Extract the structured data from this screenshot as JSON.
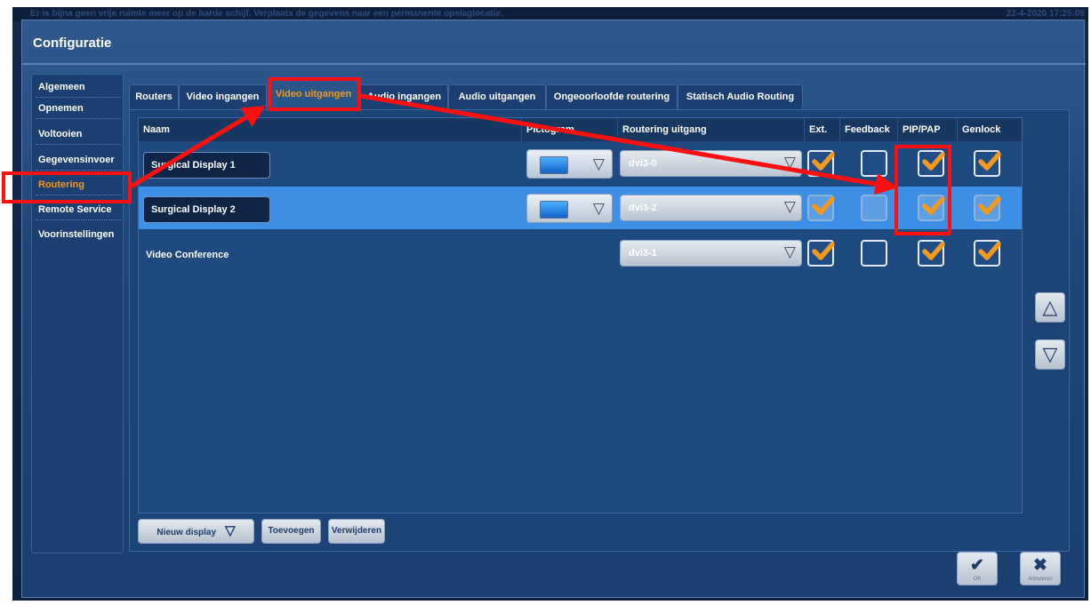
{
  "system_bar": {
    "message": "Er is bijna geen vrije ruimte meer op de harde schijf. Verplaats de gegevens naar een permanente opslaglocatie.",
    "clock": "22-4-2020  17:25:09"
  },
  "dialog": {
    "title": "Configuratie"
  },
  "sidebar": {
    "items": [
      {
        "label": "Algemeen"
      },
      {
        "label": "Opnemen"
      },
      {
        "label": "Voltooien"
      },
      {
        "label": "Gegevensinvoer"
      },
      {
        "label": "Routering"
      },
      {
        "label": "Remote Service"
      },
      {
        "label": "Voorinstellingen"
      }
    ],
    "active": "Routering"
  },
  "tabs": [
    {
      "label": "Routers"
    },
    {
      "label": "Video ingangen"
    },
    {
      "label": "Video uitgangen"
    },
    {
      "label": "Audio ingangen"
    },
    {
      "label": "Audio uitgangen"
    },
    {
      "label": "Ongeoorloofde routering"
    },
    {
      "label": "Statisch Audio Routing"
    }
  ],
  "table": {
    "columns": [
      "Naam",
      "Pictogram",
      "Routering uitgang",
      "Ext.",
      "Feedback",
      "PIP/PAP",
      "Genlock"
    ],
    "rows": [
      {
        "name": "Surgical Display 1",
        "routing": "dvi3-0",
        "ext": true,
        "feedback": false,
        "pip_pap": true,
        "genlock": true,
        "selected": false
      },
      {
        "name": "Surgical Display 2",
        "routing": "dvi3-2",
        "ext": true,
        "feedback": false,
        "pip_pap": true,
        "genlock": true,
        "selected": true
      },
      {
        "name": "Video Conference",
        "routing": "dvi3-1",
        "ext": true,
        "feedback": false,
        "pip_pap": true,
        "genlock": true,
        "selected": false
      }
    ]
  },
  "bottom_buttons": {
    "new_display": "Nieuw display",
    "add": "Toevoegen",
    "remove": "Verwijderen"
  },
  "actions": {
    "ok": "OK",
    "cancel": "Annuleren"
  },
  "icons": {
    "scroll_up": "triangle-up-icon",
    "scroll_down": "triangle-down-icon",
    "ok": "check-icon",
    "cancel": "close-icon",
    "pictogram": "monitor-icon"
  },
  "colors": {
    "active_orange": "#f39a1e",
    "selected_row": "#3d8fe6",
    "annotation_red": "#ff1010"
  }
}
